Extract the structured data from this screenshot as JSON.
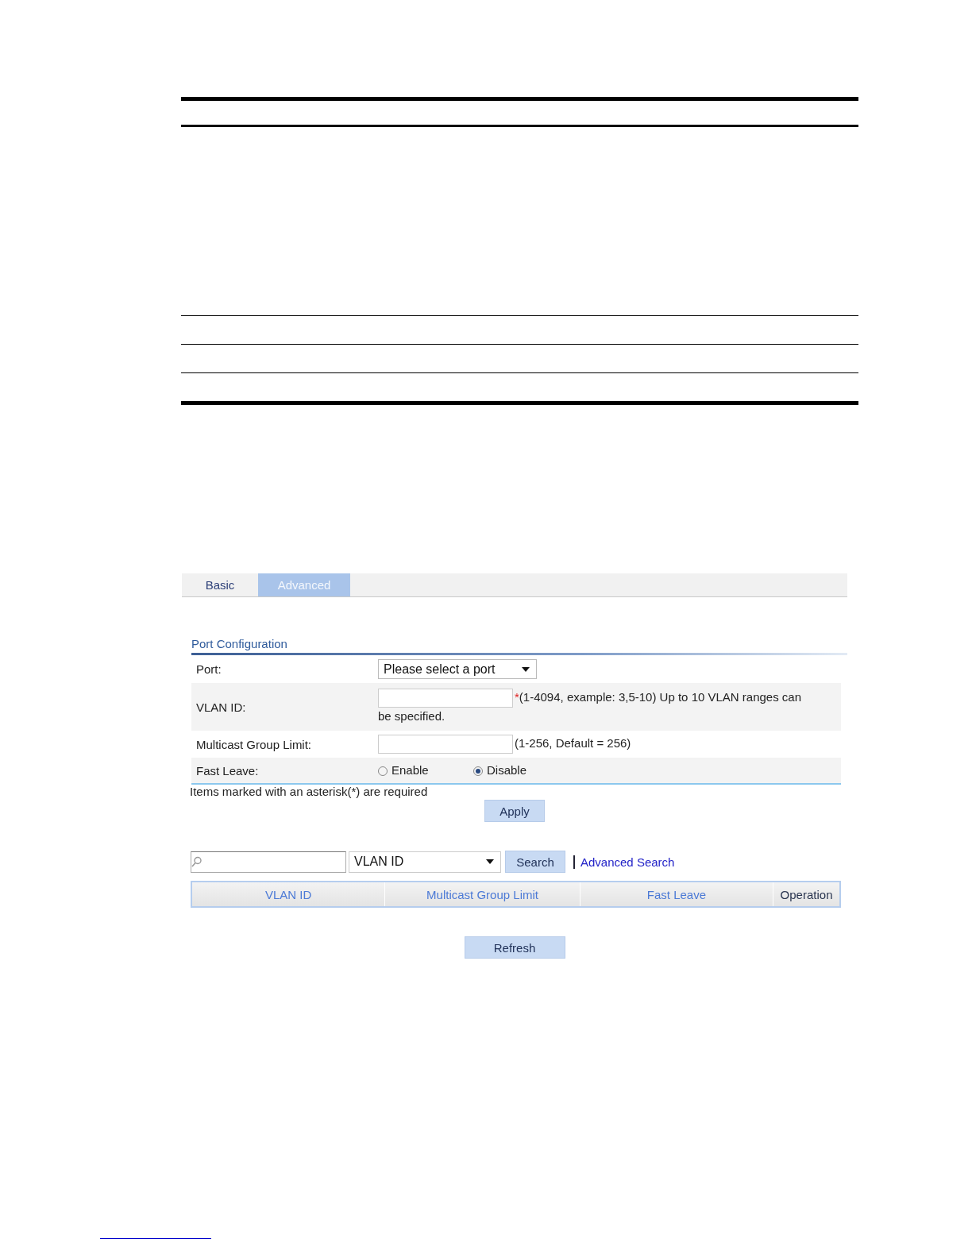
{
  "tabs": [
    {
      "label": "Basic",
      "selected": false
    },
    {
      "label": "Advanced",
      "selected": true
    }
  ],
  "section_title": "Port Configuration",
  "fields": [
    {
      "kind": "select",
      "label": "Port:",
      "value": "Please select a port"
    },
    {
      "kind": "text",
      "label": "VLAN ID:",
      "required_mark": "*",
      "hint_lines": [
        "(1-4094, example: 3,5-10) Up to 10 VLAN ranges can",
        "be specified."
      ]
    },
    {
      "kind": "text",
      "label": "Multicast Group Limit:",
      "hint": "(1-256, Default = 256)"
    },
    {
      "kind": "radio",
      "label": "Fast Leave:",
      "options": [
        {
          "label": "Enable",
          "selected": false
        },
        {
          "label": "Disable",
          "selected": true
        }
      ]
    }
  ],
  "note": "Items marked with an asterisk(*) are required",
  "apply_button": "Apply",
  "search": {
    "filter": "VLAN ID",
    "button": "Search",
    "link": "Advanced Search"
  },
  "table": {
    "columns": [
      {
        "label": "VLAN ID",
        "sortable": true
      },
      {
        "label": "Multicast Group Limit",
        "sortable": true
      },
      {
        "label": "Fast Leave",
        "sortable": true
      },
      {
        "label": "Operation",
        "sortable": false
      }
    ]
  },
  "refresh_button": "Refresh"
}
